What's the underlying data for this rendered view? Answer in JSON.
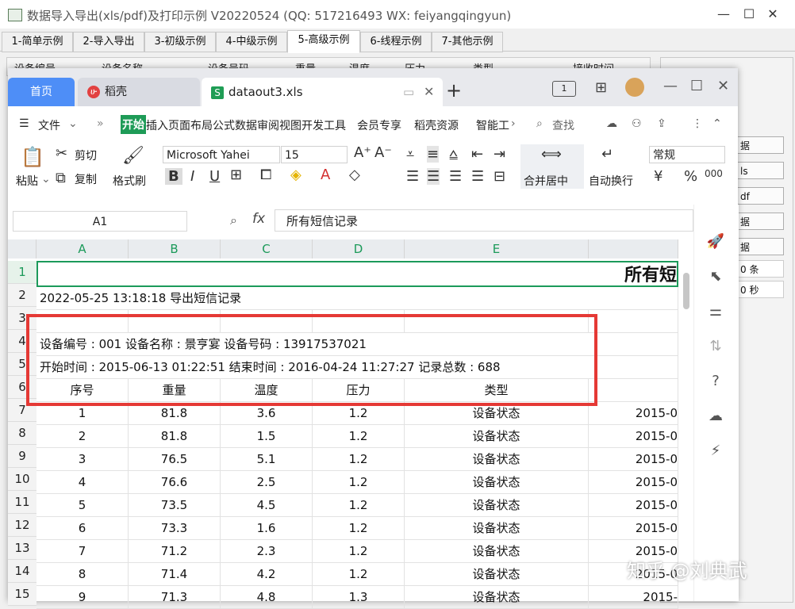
{
  "outer": {
    "title": "数据导入导出(xls/pdf)及打印示例 V20220524 (QQ: 517216493 WX: feiyangqingyun)",
    "controls": [
      "—",
      "☐",
      "✕"
    ],
    "tabs": [
      "1-简单示例",
      "2-导入导出",
      "3-初级示例",
      "4-中级示例",
      "5-高级示例",
      "6-线程示例",
      "7-其他示例"
    ],
    "bg_headers": [
      "设备编号",
      "设备名称",
      "设备号码",
      "重量",
      "温度",
      "压力",
      "类型",
      "接收时间"
    ],
    "right_buttons": [
      "据",
      "ls",
      "df",
      "据",
      "据",
      "0 条",
      "0 秒"
    ]
  },
  "wps": {
    "tab_home": "首页",
    "tab_daoke": "稻壳",
    "tab_file": "dataout3.xls",
    "menu_file": "文件",
    "menus": [
      "开始",
      "插入",
      "页面",
      "布局",
      "公式",
      "数据",
      "审阅",
      "视图",
      "开发工具",
      "会员专享",
      "稻壳资源",
      "智能工"
    ],
    "search": "查找",
    "ribbon": {
      "paste": "粘贴",
      "cut": "剪切",
      "copy": "复制",
      "format_painter": "格式刷",
      "font": "Microsoft Yahei",
      "size": "15",
      "merge": "合并居中",
      "wrap": "自动换行",
      "numfmt": "常规"
    },
    "namebox": "A1",
    "fx": "fx",
    "formula": "所有短信记录"
  },
  "sheet": {
    "columns": [
      "A",
      "B",
      "C",
      "D",
      "E"
    ],
    "row_numbers": [
      "1",
      "2",
      "3",
      "4",
      "5",
      "6",
      "7",
      "8",
      "9",
      "10",
      "11",
      "12",
      "13",
      "14",
      "15"
    ],
    "title": "所有短",
    "export_line": "2022-05-25 13:18:18 导出短信记录",
    "device_line": "设备编号 : 001    设备名称 : 景亨宴    设备号码 : 13917537021",
    "time_line": "开始时间 : 2015-06-13 01:22:51    结束时间 : 2016-04-24 11:27:27    记录总数 : 688",
    "headers": [
      "序号",
      "重量",
      "温度",
      "压力",
      "类型"
    ],
    "rows": [
      [
        "1",
        "81.8",
        "3.6",
        "1.2",
        "设备状态",
        "2015-0"
      ],
      [
        "2",
        "81.8",
        "1.5",
        "1.2",
        "设备状态",
        "2015-0"
      ],
      [
        "3",
        "76.5",
        "5.1",
        "1.2",
        "设备状态",
        "2015-0"
      ],
      [
        "4",
        "76.6",
        "2.5",
        "1.2",
        "设备状态",
        "2015-0"
      ],
      [
        "5",
        "73.5",
        "4.5",
        "1.2",
        "设备状态",
        "2015-0"
      ],
      [
        "6",
        "73.3",
        "1.6",
        "1.2",
        "设备状态",
        "2015-0"
      ],
      [
        "7",
        "71.2",
        "2.3",
        "1.2",
        "设备状态",
        "2015-0"
      ],
      [
        "8",
        "71.4",
        "4.2",
        "1.2",
        "设备状态",
        "2015-0"
      ],
      [
        "9",
        "71.3",
        "4.8",
        "1.3",
        "设备状态",
        "2015-"
      ]
    ]
  },
  "watermark": "知乎 @刘典武"
}
